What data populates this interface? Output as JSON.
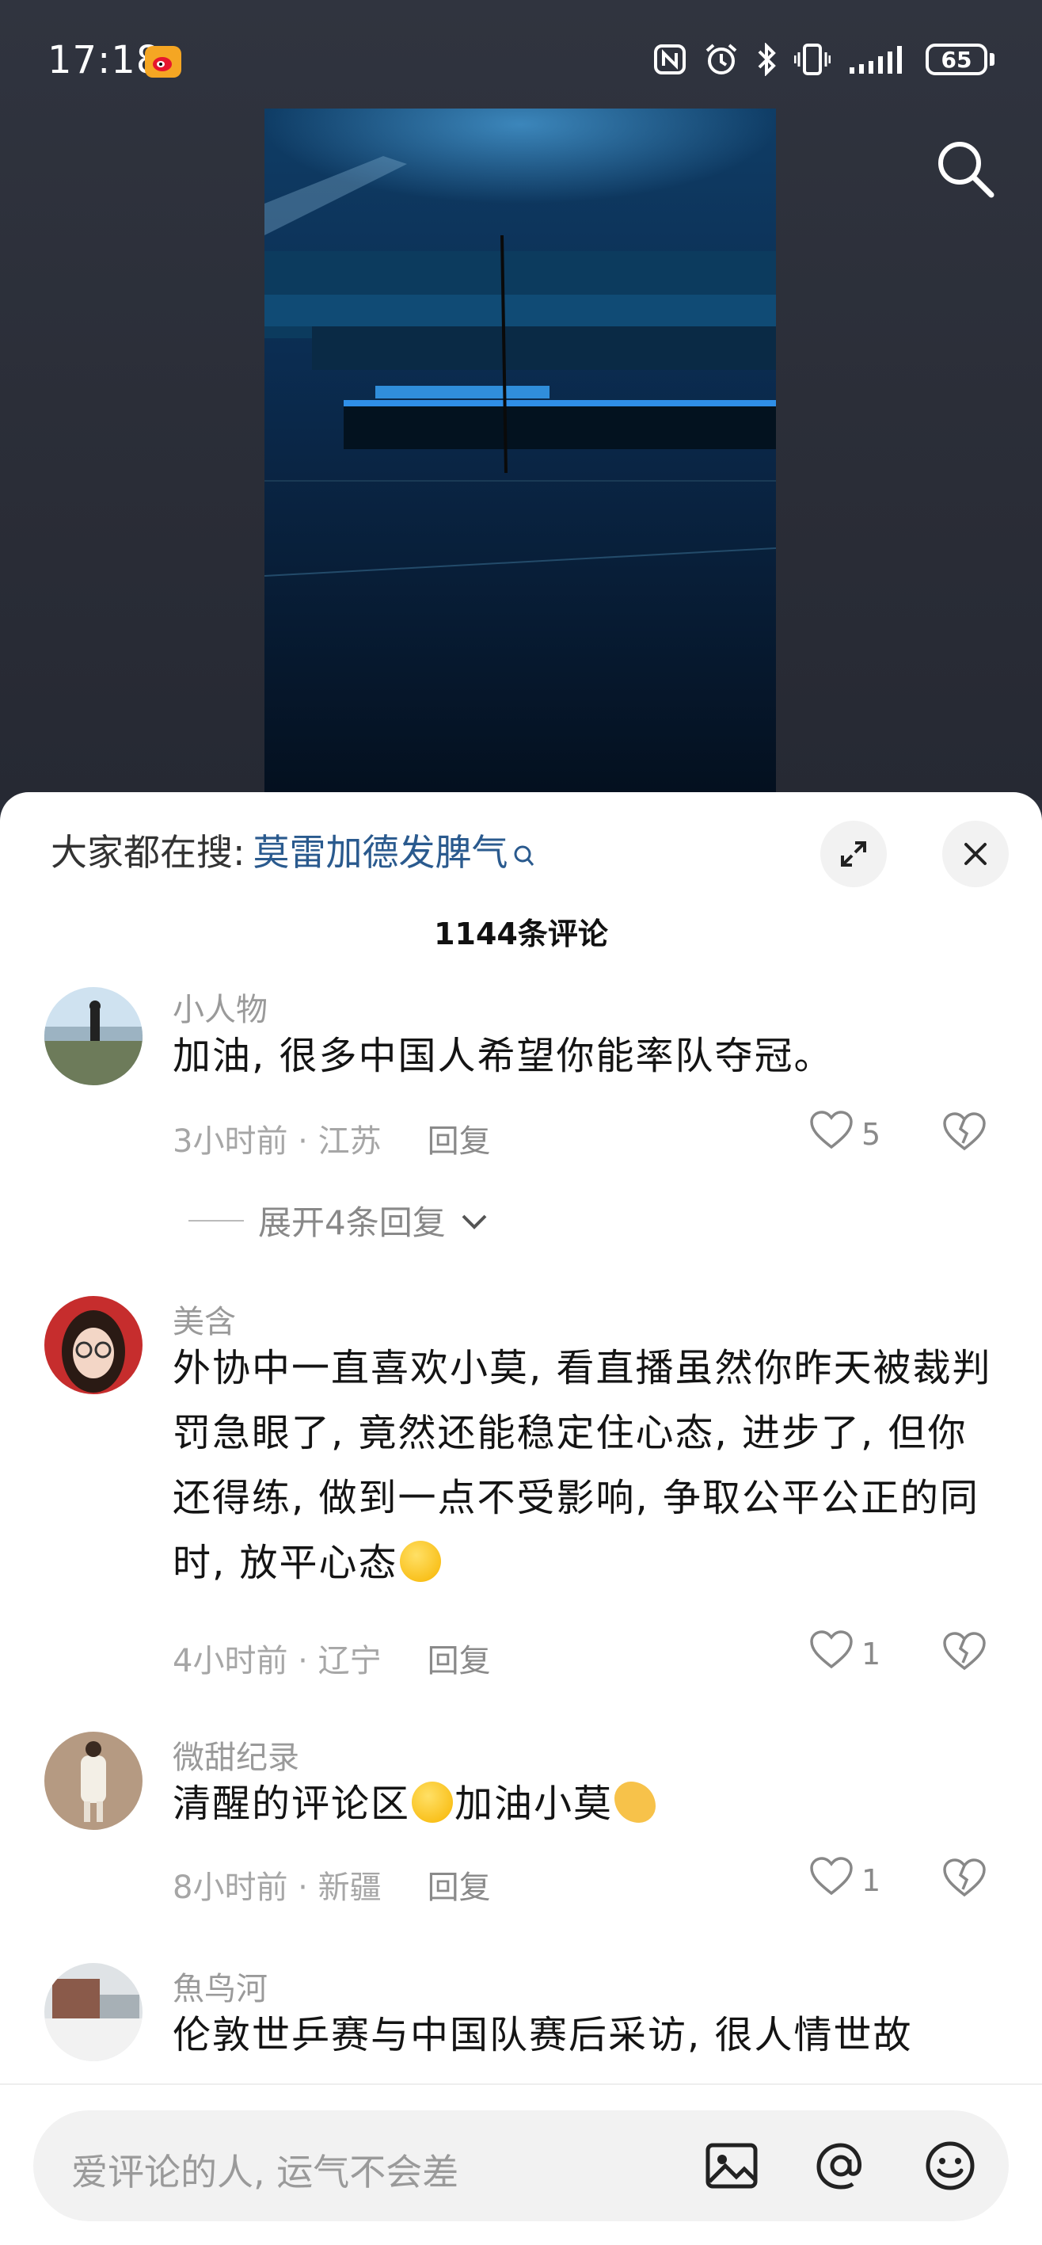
{
  "status": {
    "time": "17:18",
    "battery": "65"
  },
  "sheet": {
    "hot_search_label": "大家都在搜:",
    "hot_search_keyword": "莫雷加德发脾气",
    "comment_count": "1144条评论"
  },
  "comments": [
    {
      "name": "小人物",
      "text": "加油, 很多中国人希望你能率队夺冠。",
      "time": "3小时前",
      "location": "江苏",
      "reply": "回复",
      "likes": "5",
      "expand": "展开4条回复"
    },
    {
      "name": "美含",
      "text": "外协中一直喜欢小莫, 看直播虽然你昨天被裁判罚急眼了, 竟然还能稳定住心态, 进步了, 但你还得练, 做到一点不受影响, 争取公平公正的同时, 放平心态",
      "time": "4小时前",
      "location": "辽宁",
      "reply": "回复",
      "likes": "1"
    },
    {
      "name": "微甜纪录",
      "text_a": "清醒的评论区",
      "text_b": "加油小莫",
      "time": "8小时前",
      "location": "新疆",
      "reply": "回复",
      "likes": "1"
    },
    {
      "name": "魚鸟河",
      "text": "伦敦世乒赛与中国队赛后采访, 很人情世故"
    }
  ],
  "input": {
    "placeholder": "爱评论的人, 运气不会差"
  },
  "icons": [
    "weibo-icon",
    "nfc-icon",
    "alarm-icon",
    "bluetooth-icon",
    "vibrate-icon",
    "signal-icon",
    "battery-icon",
    "search-icon",
    "expand-icon",
    "close-icon",
    "heart-icon",
    "broken-heart-icon",
    "chevron-down-icon",
    "image-icon",
    "at-icon",
    "emoji-icon"
  ],
  "colors": {
    "keyword": "#2a5a8e",
    "sheet": "#ffffff",
    "top_bg": "#2b2f3a"
  }
}
